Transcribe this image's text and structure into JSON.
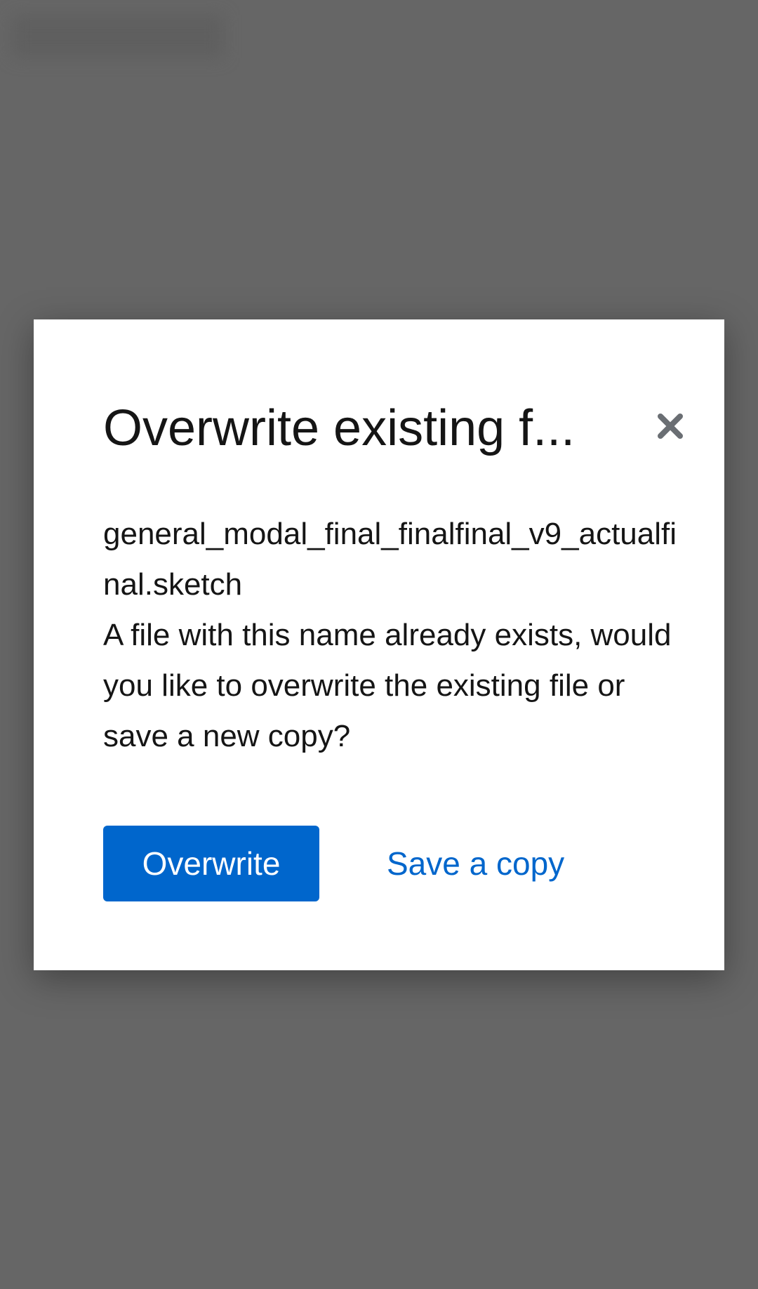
{
  "modal": {
    "title": "Overwrite existing f...",
    "close_icon": "close-icon",
    "filename": "general_modal_final_finalfinal_v9_actualfinal.sketch",
    "message": "A file with this name already exists, would you like to overwrite the existing file or save a new copy?",
    "primary_label": "Overwrite",
    "secondary_label": "Save a copy"
  },
  "colors": {
    "backdrop": "#666666",
    "primary": "#0066cc",
    "text": "#151515",
    "close_icon": "#6a6e73"
  }
}
